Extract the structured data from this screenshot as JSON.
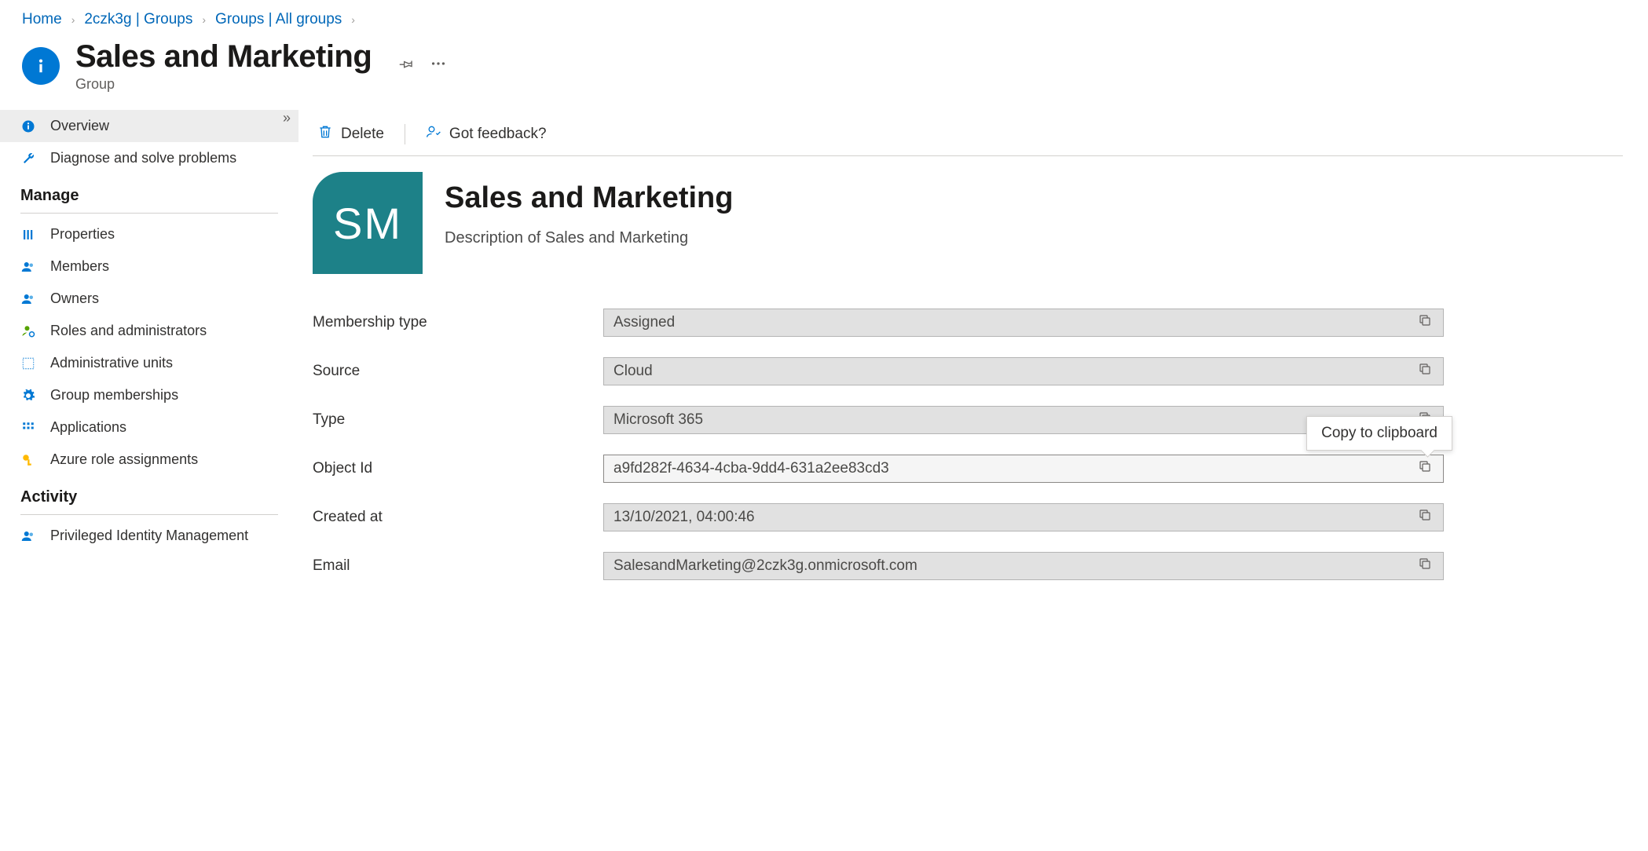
{
  "breadcrumb": [
    {
      "label": "Home"
    },
    {
      "label": "2czk3g | Groups"
    },
    {
      "label": "Groups | All groups"
    }
  ],
  "header": {
    "title": "Sales and Marketing",
    "subtitle": "Group"
  },
  "sidebar": {
    "top": [
      {
        "id": "overview",
        "label": "Overview",
        "selected": true,
        "icon": "info"
      },
      {
        "id": "diagnose",
        "label": "Diagnose and solve problems",
        "selected": false,
        "icon": "wrench"
      }
    ],
    "manage_label": "Manage",
    "manage": [
      {
        "id": "properties",
        "label": "Properties",
        "icon": "bars"
      },
      {
        "id": "members",
        "label": "Members",
        "icon": "people"
      },
      {
        "id": "owners",
        "label": "Owners",
        "icon": "people"
      },
      {
        "id": "roles",
        "label": "Roles and administrators",
        "icon": "person-gear"
      },
      {
        "id": "adminunits",
        "label": "Administrative units",
        "icon": "grid-dashed"
      },
      {
        "id": "groupmem",
        "label": "Group memberships",
        "icon": "gear"
      },
      {
        "id": "apps",
        "label": "Applications",
        "icon": "grid"
      },
      {
        "id": "azurerole",
        "label": "Azure role assignments",
        "icon": "key"
      }
    ],
    "activity_label": "Activity",
    "activity": [
      {
        "id": "pim",
        "label": "Privileged Identity Management",
        "icon": "people"
      }
    ]
  },
  "toolbar": {
    "delete_label": "Delete",
    "feedback_label": "Got feedback?"
  },
  "entity": {
    "initials": "SM",
    "name": "Sales and Marketing",
    "description": "Description of Sales and Marketing"
  },
  "details": [
    {
      "label": "Membership type",
      "value": "Assigned"
    },
    {
      "label": "Source",
      "value": "Cloud"
    },
    {
      "label": "Type",
      "value": "Microsoft 365"
    },
    {
      "label": "Object Id",
      "value": "a9fd282f-4634-4cba-9dd4-631a2ee83cd3",
      "tooltip": "Copy to clipboard",
      "hover": true
    },
    {
      "label": "Created at",
      "value": "13/10/2021, 04:00:46"
    },
    {
      "label": "Email",
      "value": "SalesandMarketing@2czk3g.onmicrosoft.com"
    }
  ],
  "tooltip_text": "Copy to clipboard"
}
